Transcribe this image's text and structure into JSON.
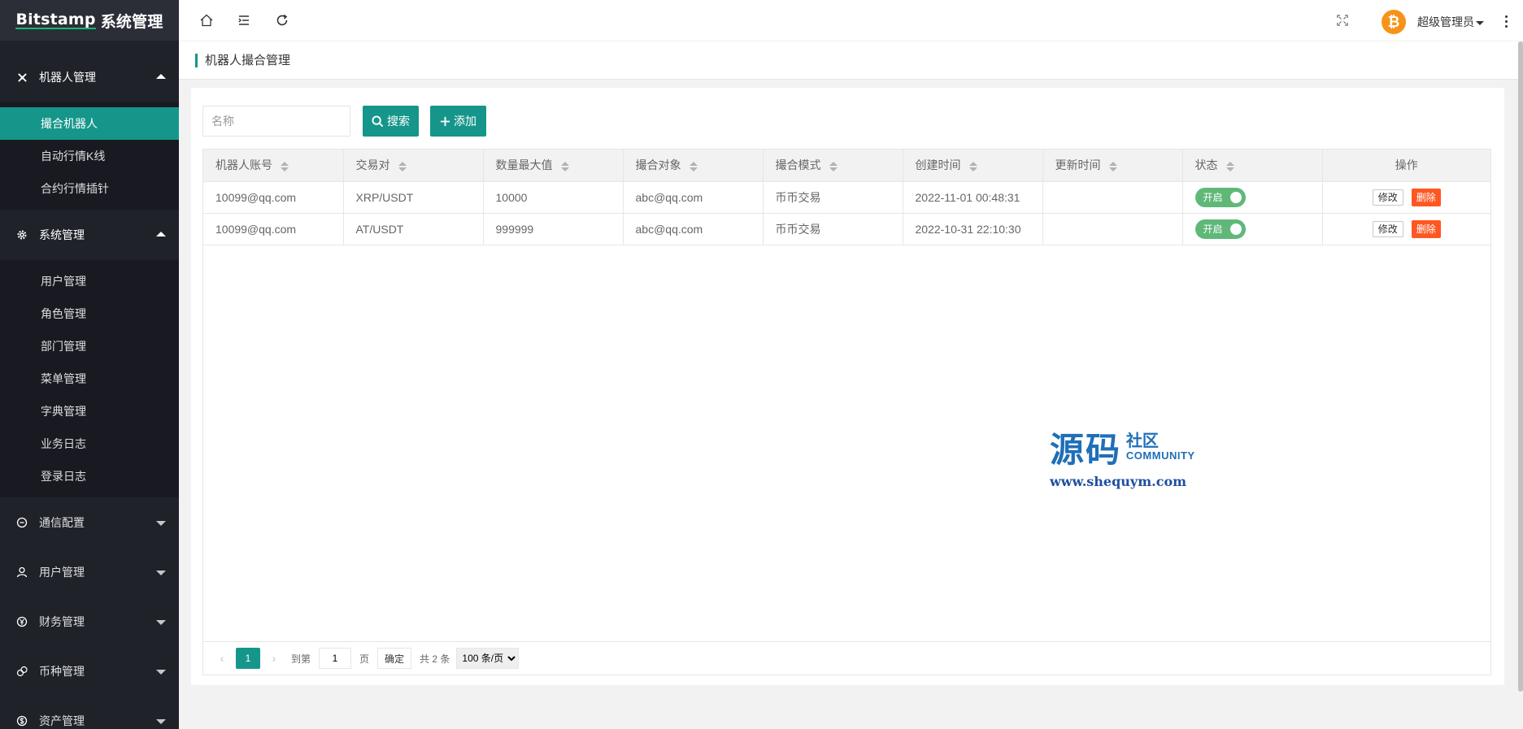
{
  "app": {
    "logo_prefix": "Bitstamp",
    "logo_suffix": "系统管理"
  },
  "sidebar": {
    "groups": [
      {
        "label": "机器人管理",
        "icon": "robot-icon",
        "expanded": true,
        "items": [
          {
            "label": "撮合机器人",
            "active": true
          },
          {
            "label": "自动行情K线"
          },
          {
            "label": "合约行情插针"
          }
        ]
      },
      {
        "label": "系统管理",
        "icon": "gear-icon",
        "expanded": true,
        "items": [
          {
            "label": "用户管理"
          },
          {
            "label": "角色管理"
          },
          {
            "label": "部门管理"
          },
          {
            "label": "菜单管理"
          },
          {
            "label": "字典管理"
          },
          {
            "label": "业务日志"
          },
          {
            "label": "登录日志"
          }
        ]
      },
      {
        "label": "通信配置",
        "icon": "message-icon",
        "expanded": false
      },
      {
        "label": "用户管理",
        "icon": "user-icon",
        "expanded": false
      },
      {
        "label": "财务管理",
        "icon": "yen-icon",
        "expanded": false
      },
      {
        "label": "币种管理",
        "icon": "coin-icon",
        "expanded": false
      },
      {
        "label": "资产管理",
        "icon": "dollar-icon",
        "expanded": false
      }
    ]
  },
  "topbar": {
    "user_name": "超级管理员",
    "avatar_letter": "₿",
    "avatar_color": "#f7931a"
  },
  "page": {
    "title": "机器人撮合管理"
  },
  "search": {
    "placeholder": "名称",
    "search_label": "搜索",
    "add_label": "添加"
  },
  "table": {
    "columns": [
      "机器人账号",
      "交易对",
      "数量最大值",
      "撮合对象",
      "撮合模式",
      "创建时间",
      "更新时间",
      "状态",
      "操作"
    ],
    "rows": [
      {
        "account": "10099@qq.com",
        "pair": "XRP/USDT",
        "max_qty": "10000",
        "target": "abc@qq.com",
        "mode": "币币交易",
        "created": "2022-11-01 00:48:31",
        "updated": "",
        "status": "开启",
        "edit": "修改",
        "delete": "删除"
      },
      {
        "account": "10099@qq.com",
        "pair": "AT/USDT",
        "max_qty": "999999",
        "target": "abc@qq.com",
        "mode": "币币交易",
        "created": "2022-10-31 22:10:30",
        "updated": "",
        "status": "开启",
        "edit": "修改",
        "delete": "删除"
      }
    ]
  },
  "pager": {
    "current_page": "1",
    "goto_prefix": "到第",
    "goto_value": "1",
    "goto_suffix": "页",
    "confirm": "确定",
    "total": "共 2 条",
    "page_size": "100 条/页"
  },
  "watermark": {
    "big": "源码",
    "cn": "社区",
    "en": "COMMUNITY",
    "url": "www.shequym.com"
  },
  "colors": {
    "accent": "#16968a",
    "sidebar_bg": "#20222a",
    "danger": "#ff5722",
    "switch_on": "#5fb878"
  }
}
